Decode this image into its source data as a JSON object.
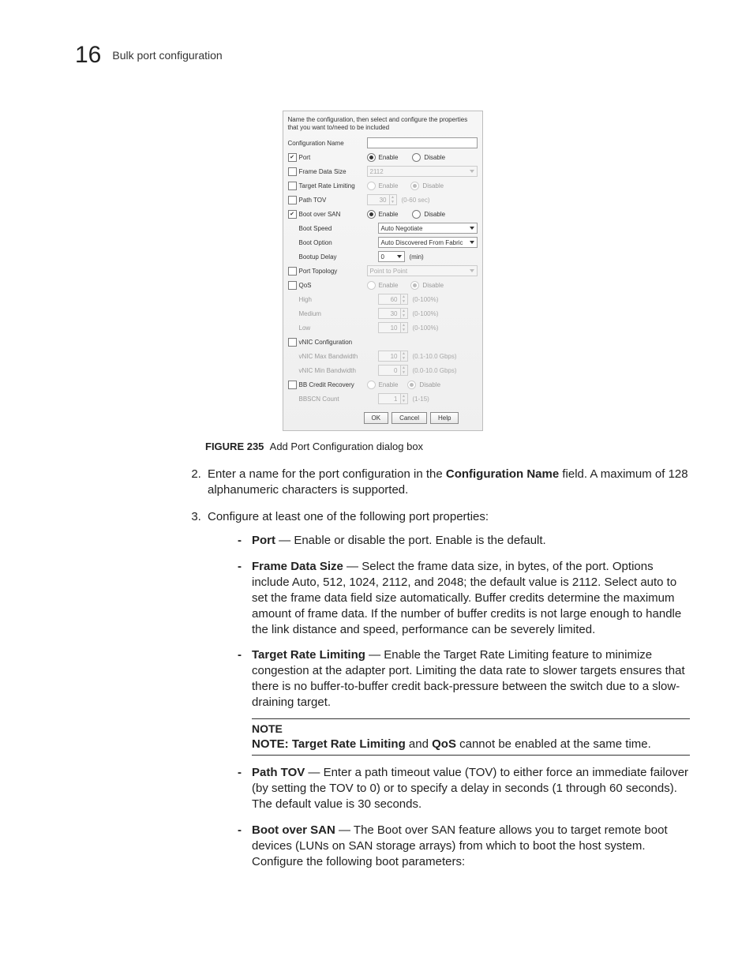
{
  "header": {
    "chapter_number": "16",
    "chapter_title": "Bulk port configuration"
  },
  "dialog": {
    "intro": "Name the configuration, then select and configure the properties that you want to/need to be included",
    "rows": {
      "config_name_label": "Configuration Name",
      "port": {
        "label": "Port",
        "checked": true,
        "enable": "Enable",
        "disable": "Disable"
      },
      "frame_data_size": {
        "label": "Frame Data Size",
        "checked": false,
        "value": "2112"
      },
      "target_rate": {
        "label": "Target Rate Limiting",
        "checked": false,
        "enable": "Enable",
        "disable": "Disable"
      },
      "path_tov": {
        "label": "Path TOV",
        "checked": false,
        "value": "30",
        "hint": "(0-60 sec)"
      },
      "boot_over_san": {
        "label": "Boot over SAN",
        "checked": true,
        "enable": "Enable",
        "disable": "Disable"
      },
      "boot_speed": {
        "label": "Boot Speed",
        "value": "Auto Negotiate"
      },
      "boot_option": {
        "label": "Boot Option",
        "value": "Auto Discovered From Fabric"
      },
      "bootup_delay": {
        "label": "Bootup Delay",
        "value": "0",
        "unit": "(min)"
      },
      "port_topology": {
        "label": "Port Topology",
        "checked": false,
        "value": "Point to Point"
      },
      "qos": {
        "label": "QoS",
        "checked": false,
        "enable": "Enable",
        "disable": "Disable",
        "high": {
          "label": "High",
          "value": "60",
          "hint": "(0-100%)"
        },
        "medium": {
          "label": "Medium",
          "value": "30",
          "hint": "(0-100%)"
        },
        "low": {
          "label": "Low",
          "value": "10",
          "hint": "(0-100%)"
        }
      },
      "vnic": {
        "label": "vNIC Configuration",
        "checked": false,
        "max": {
          "label": "vNIC Max Bandwidth",
          "value": "10",
          "hint": "(0.1-10.0 Gbps)"
        },
        "min": {
          "label": "vNIC Min Bandwidth",
          "value": "0",
          "hint": "(0.0-10.0 Gbps)"
        }
      },
      "bb_credit": {
        "label": "BB Credit Recovery",
        "checked": false,
        "enable": "Enable",
        "disable": "Disable",
        "count": {
          "label": "BBSCN Count",
          "value": "1",
          "hint": "(1-15)"
        }
      }
    },
    "buttons": {
      "ok": "OK",
      "cancel": "Cancel",
      "help": "Help"
    }
  },
  "figure": {
    "number": "FIGURE 235",
    "caption": "Add Port Configuration dialog box"
  },
  "steps": {
    "s2a": "Enter a name for the port configuration in the ",
    "s2b": "Configuration Name",
    "s2c": " field. A maximum of 128 alphanumeric characters is supported.",
    "s3": "Configure at least one of the following port properties:",
    "bullets": {
      "port": {
        "head": "Port",
        "rest": " — Enable or disable the port. Enable is the default."
      },
      "fds": {
        "head": "Frame Data Size",
        "rest": " — Select the frame data size, in bytes, of the port. Options include Auto, 512, 1024, 2112, and 2048; the default value is 2112. Select auto to set the frame data field size automatically.  Buffer credits determine the maximum amount of frame data. If the number of buffer credits is not large enough to handle the link distance and speed, performance can be severely limited."
      },
      "trl": {
        "head": "Target Rate Limiting",
        "rest": " — Enable the Target Rate Limiting feature to minimize congestion at the adapter port. Limiting the data rate to slower targets ensures that there is no buffer-to-buffer credit back-pressure between the switch due to a slow-draining target."
      },
      "note": {
        "head": "NOTE",
        "body_a": "NOTE: Target Rate Limiting",
        "body_b": " and ",
        "body_c": "QoS",
        "body_d": " cannot be enabled at the same time."
      },
      "ptov": {
        "head": "Path TOV",
        "rest": " — Enter a path timeout value (TOV) to either force an immediate failover (by setting the TOV to 0) or to specify a delay in seconds (1 through 60 seconds). The default value is 30 seconds."
      },
      "bos": {
        "head": "Boot over SAN",
        "rest": " — The Boot over SAN feature allows you to target remote boot devices (LUNs on SAN storage arrays) from which to boot the host system. Configure the following boot parameters:"
      }
    }
  }
}
